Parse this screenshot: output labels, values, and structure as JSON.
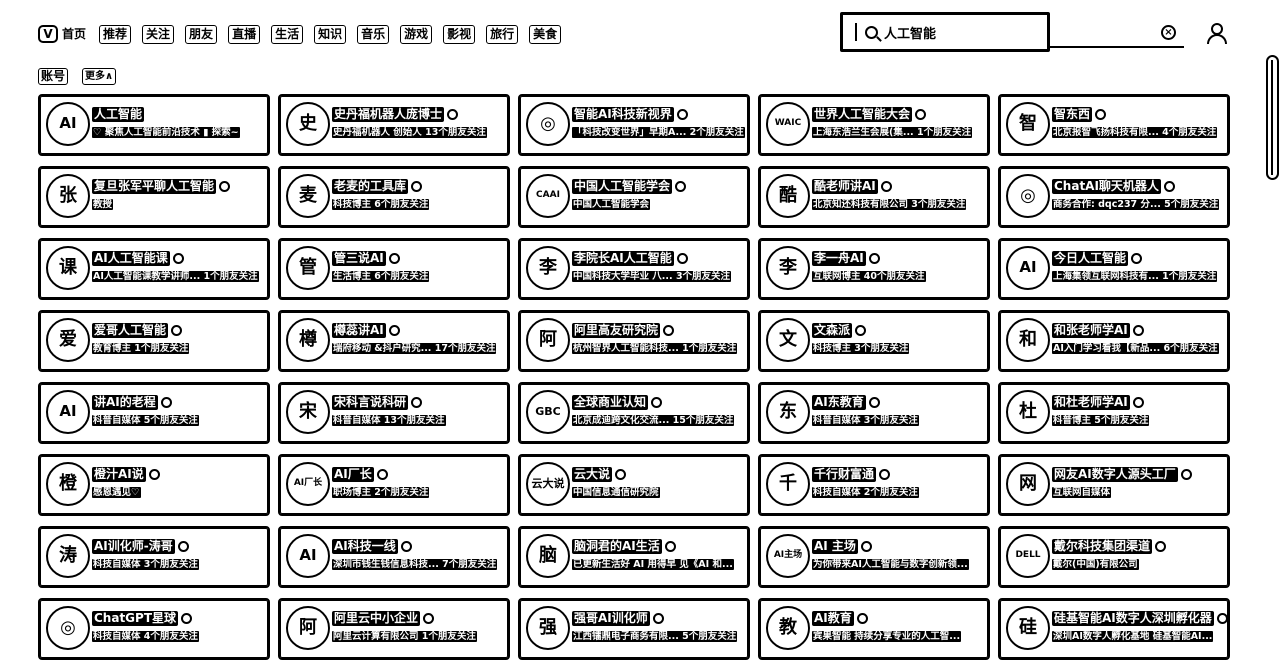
{
  "nav": {
    "logo": "V",
    "items": [
      "首页",
      "推荐",
      "关注",
      "朋友",
      "直播",
      "生活",
      "知识",
      "音乐",
      "游戏",
      "影视",
      "旅行",
      "美食"
    ]
  },
  "search": {
    "query": "人工智能",
    "clear_icon": "close-circle-icon"
  },
  "filters": {
    "account_label": "账号",
    "more_label": "更多∧"
  },
  "cards": [
    {
      "name": "人工智能",
      "avatar": "AI",
      "desc": "♡ 聚焦人工智能前沿技术 ▮ 探索~"
    },
    {
      "name": "史丹福机器人庞博士",
      "avatar": "史",
      "desc": "史丹福机器人 创始人 13个朋友关注"
    },
    {
      "name": "智能AI科技新视界",
      "avatar": "◎",
      "desc": "「科技改变世界」早期A... 2个朋友关注"
    },
    {
      "name": "世界人工智能大会",
      "avatar": "WAIC",
      "desc": "上海东浩兰生会展(集... 1个朋友关注"
    },
    {
      "name": "智东西",
      "avatar": "智",
      "desc": "北京报智飞扬科技有限... 4个朋友关注"
    },
    {
      "name": "复旦张军平聊人工智能",
      "avatar": "张",
      "desc": "教授"
    },
    {
      "name": "老麦的工具库",
      "avatar": "麦",
      "desc": "科技博主 6个朋友关注"
    },
    {
      "name": "中国人工智能学会",
      "avatar": "CAAI",
      "desc": "中国人工智能学会"
    },
    {
      "name": "酷老师讲AI",
      "avatar": "酷",
      "desc": "北京知还科技有限公司 3个朋友关注"
    },
    {
      "name": "ChatAI聊天机器人",
      "avatar": "◎",
      "desc": "商务合作: dqc237 分... 5个朋友关注"
    },
    {
      "name": "AI人工智能课",
      "avatar": "课",
      "desc": "AI人工智能课教学讲师... 1个朋友关注"
    },
    {
      "name": "管三说AI",
      "avatar": "管",
      "desc": "生活博主 6个朋友关注"
    },
    {
      "name": "李院长AI人工智能",
      "avatar": "李",
      "desc": "中国科技大学毕业 八... 3个朋友关注"
    },
    {
      "name": "李一舟AI",
      "avatar": "李",
      "desc": "互联网博主 40个朋友关注"
    },
    {
      "name": "今日人工智能",
      "avatar": "AI",
      "desc": "上海集领互联网科技有... 1个朋友关注"
    },
    {
      "name": "爱哥人工智能",
      "avatar": "爱",
      "desc": "教育博主 1个朋友关注"
    },
    {
      "name": "樽蕊讲AI",
      "avatar": "樽",
      "desc": "瑞府移动 &抖户研究... 17个朋友关注"
    },
    {
      "name": "阿里高友研究院",
      "avatar": "阿",
      "desc": "杭州智界人工智能科技... 1个朋友关注"
    },
    {
      "name": "文森派",
      "avatar": "文",
      "desc": "科技博主 3个朋友关注"
    },
    {
      "name": "和张老师学AI",
      "avatar": "和",
      "desc": "AI入门学习看我【新品... 6个朋友关注"
    },
    {
      "name": "讲AI的老程",
      "avatar": "AI",
      "desc": "科普自媒体 5个朋友关注"
    },
    {
      "name": "宋科言说科研",
      "avatar": "宋",
      "desc": "科普自媒体 13个朋友关注"
    },
    {
      "name": "全球商业认知",
      "avatar": "GBC",
      "desc": "北京成迪跨文化交流... 15个朋友关注"
    },
    {
      "name": "AI东教育",
      "avatar": "东",
      "desc": "科普自媒体 3个朋友关注"
    },
    {
      "name": "和杜老师学AI",
      "avatar": "杜",
      "desc": "科普博主 5个朋友关注"
    },
    {
      "name": "橙汁AI说",
      "avatar": "橙",
      "desc": "感恩遇见♡"
    },
    {
      "name": "AI厂长",
      "avatar": "AI厂长",
      "desc": "职场博主 2个朋友关注"
    },
    {
      "name": "云大说",
      "avatar": "云大说",
      "desc": "中国信息通信研究院"
    },
    {
      "name": "千行财富通",
      "avatar": "千",
      "desc": "科技自媒体 2个朋友关注"
    },
    {
      "name": "网友AI数字人源头工厂",
      "avatar": "网",
      "desc": "互联网自媒体"
    },
    {
      "name": "AI训化师-涛哥",
      "avatar": "涛",
      "desc": "科技自媒体 3个朋友关注"
    },
    {
      "name": "AI科技一线",
      "avatar": "AI",
      "desc": "深圳市钱生钱信息科技... 7个朋友关注"
    },
    {
      "name": "脑洞君的AI生活",
      "avatar": "脑",
      "desc": "已更新生活好 AI 用得早 见《AI 和..."
    },
    {
      "name": "AI 主场",
      "avatar": "AI主场",
      "desc": "为你带来AI人工智能与数字创新领..."
    },
    {
      "name": "戴尔科技集团渠道",
      "avatar": "DELL",
      "desc": "戴尔(中国)有限公司"
    },
    {
      "name": "ChatGPT星球",
      "avatar": "◎",
      "desc": "科技自媒体 4个朋友关注"
    },
    {
      "name": "阿里云中小企业",
      "avatar": "阿",
      "desc": "阿里云计算有限公司 1个朋友关注"
    },
    {
      "name": "强哥AI训化师",
      "avatar": "强",
      "desc": "江西镭鼎电子商务有限... 5个朋友关注"
    },
    {
      "name": "AI教育",
      "avatar": "教",
      "desc": "宾果智能 持续分享专业的人工智..."
    },
    {
      "name": "硅基智能AI数字人深圳孵化器",
      "avatar": "硅",
      "desc": "深圳AI数字人孵化基地 硅基智能AI..."
    }
  ]
}
